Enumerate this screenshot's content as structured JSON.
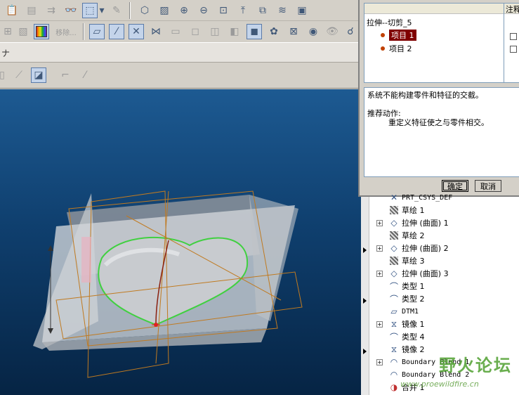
{
  "toolbar3": {
    "caret": "ナ"
  },
  "toolbar2": {
    "remove_label": "移除..."
  },
  "dialog": {
    "feature_name": "拉伸--切剪_5",
    "note_header": "注释",
    "items": [
      {
        "label": "项目 1",
        "selected": true
      },
      {
        "label": "项目 2",
        "selected": false
      }
    ],
    "message_line1": "系统不能构建零件和特征的交截。",
    "message_line2": "推荐动作:",
    "message_line3": "重定义特征使之与零件相交。",
    "ok_label": "确定",
    "cancel_label": "取消"
  },
  "model_tree": {
    "rows": [
      {
        "label": "PRT_CSYS_DEF",
        "icon": "csys-icon",
        "expand": false,
        "mono": true
      },
      {
        "label": "草绘 1",
        "icon": "sketch-icon",
        "expand": false
      },
      {
        "label": "拉伸 (曲面) 1",
        "icon": "extrude-surface-icon",
        "expand": true
      },
      {
        "label": "草绘 2",
        "icon": "sketch-icon",
        "expand": false
      },
      {
        "label": "拉伸 (曲面) 2",
        "icon": "extrude-surface-icon",
        "expand": true
      },
      {
        "label": "草绘 3",
        "icon": "sketch-icon",
        "expand": false
      },
      {
        "label": "拉伸 (曲面) 3",
        "icon": "extrude-surface-icon",
        "expand": true
      },
      {
        "label": "类型 1",
        "icon": "style-surface-icon",
        "expand": false
      },
      {
        "label": "类型 2",
        "icon": "style-surface-icon",
        "expand": false
      },
      {
        "label": "DTM1",
        "icon": "datum-plane-icon",
        "expand": false,
        "mono": true
      },
      {
        "label": "镜像 1",
        "icon": "mirror-icon",
        "expand": true
      },
      {
        "label": "类型 4",
        "icon": "style-surface-icon",
        "expand": false
      },
      {
        "label": "镜像 2",
        "icon": "mirror-icon",
        "expand": false
      },
      {
        "label": "Boundary Blend 1",
        "icon": "boundary-blend-icon",
        "expand": true,
        "mono": true
      },
      {
        "label": "Boundary Blend 2",
        "icon": "boundary-blend-icon",
        "expand": false,
        "mono": true
      },
      {
        "label": "合并 1",
        "icon": "merge-icon",
        "expand": false
      }
    ]
  },
  "watermark": {
    "text": "野火论坛",
    "url": "www.proewildfire.cn"
  }
}
